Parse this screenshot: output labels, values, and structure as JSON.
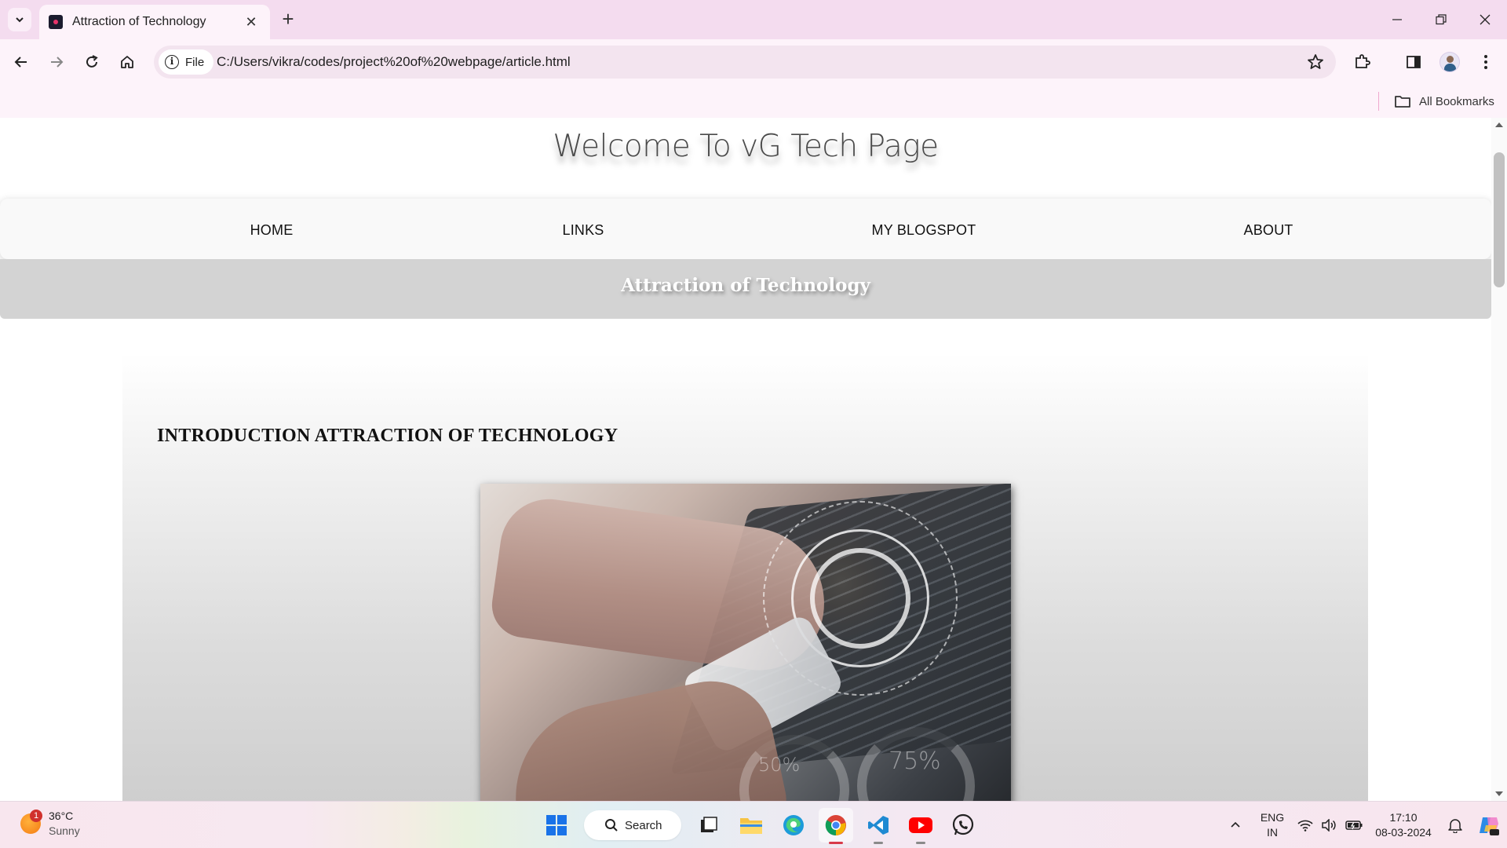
{
  "browser": {
    "tab_title": "Attraction of Technology",
    "new_tab_label": "+",
    "site_chip_label": "File",
    "url": "C:/Users/vikra/codes/project%20of%20webpage/article.html",
    "bookmarks_label": "All Bookmarks"
  },
  "page": {
    "site_title": "Welcome To vG Tech Page",
    "nav": [
      {
        "label": "HOME"
      },
      {
        "label": "LINKS"
      },
      {
        "label": "MY BLOGSPOT"
      },
      {
        "label": "ABOUT"
      }
    ],
    "banner_title": "Attraction of Technology",
    "article_heading": "INTRODUCTION ATTRACTION OF TECHNOLOGY",
    "image_gauge_labels": [
      "50%",
      "75%"
    ]
  },
  "taskbar": {
    "weather_temp": "36°C",
    "weather_condition": "Sunny",
    "weather_badge": "1",
    "search_label": "Search",
    "lang_line1": "ENG",
    "lang_line2": "IN",
    "time": "17:10",
    "date": "08-03-2024"
  },
  "colors": {
    "nav_bg": "#f9f9f9",
    "banner_bg": "#d3d3d3",
    "chrome_bg": "#fdf3fa"
  }
}
